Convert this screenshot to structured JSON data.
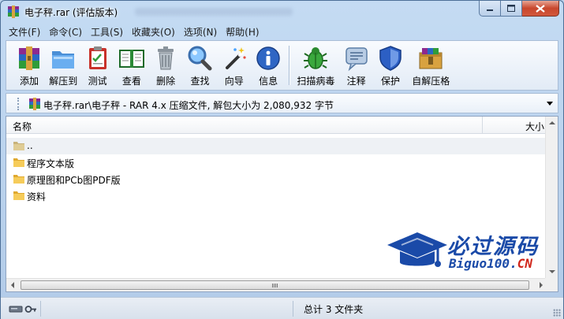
{
  "window": {
    "title": "电子秤.rar (评估版本)"
  },
  "menu": [
    "文件(F)",
    "命令(C)",
    "工具(S)",
    "收藏夹(O)",
    "选项(N)",
    "帮助(H)"
  ],
  "toolbar": {
    "add": "添加",
    "extract": "解压到",
    "test": "测试",
    "view": "查看",
    "delete": "删除",
    "find": "查找",
    "wizard": "向导",
    "info": "信息",
    "scan": "扫描病毒",
    "comment": "注释",
    "protect": "保护",
    "sfx": "自解压格"
  },
  "address": {
    "path": "电子秤.rar\\电子秤 - RAR 4.x 压缩文件, 解包大小为 2,080,932 字节"
  },
  "list": {
    "col_name": "名称",
    "col_size": "大小",
    "rows": [
      {
        "name": ".."
      },
      {
        "name": "程序文本版"
      },
      {
        "name": "原理图和PCb图PDF版"
      },
      {
        "name": "资料"
      }
    ]
  },
  "watermark": {
    "title": "必过源码",
    "sub_main": "Biguo100.",
    "sub_red": "CN"
  },
  "status": {
    "text": "总计 3 文件夹"
  },
  "colors": {
    "accent": "#1a4aa8",
    "close": "#c8472d"
  }
}
